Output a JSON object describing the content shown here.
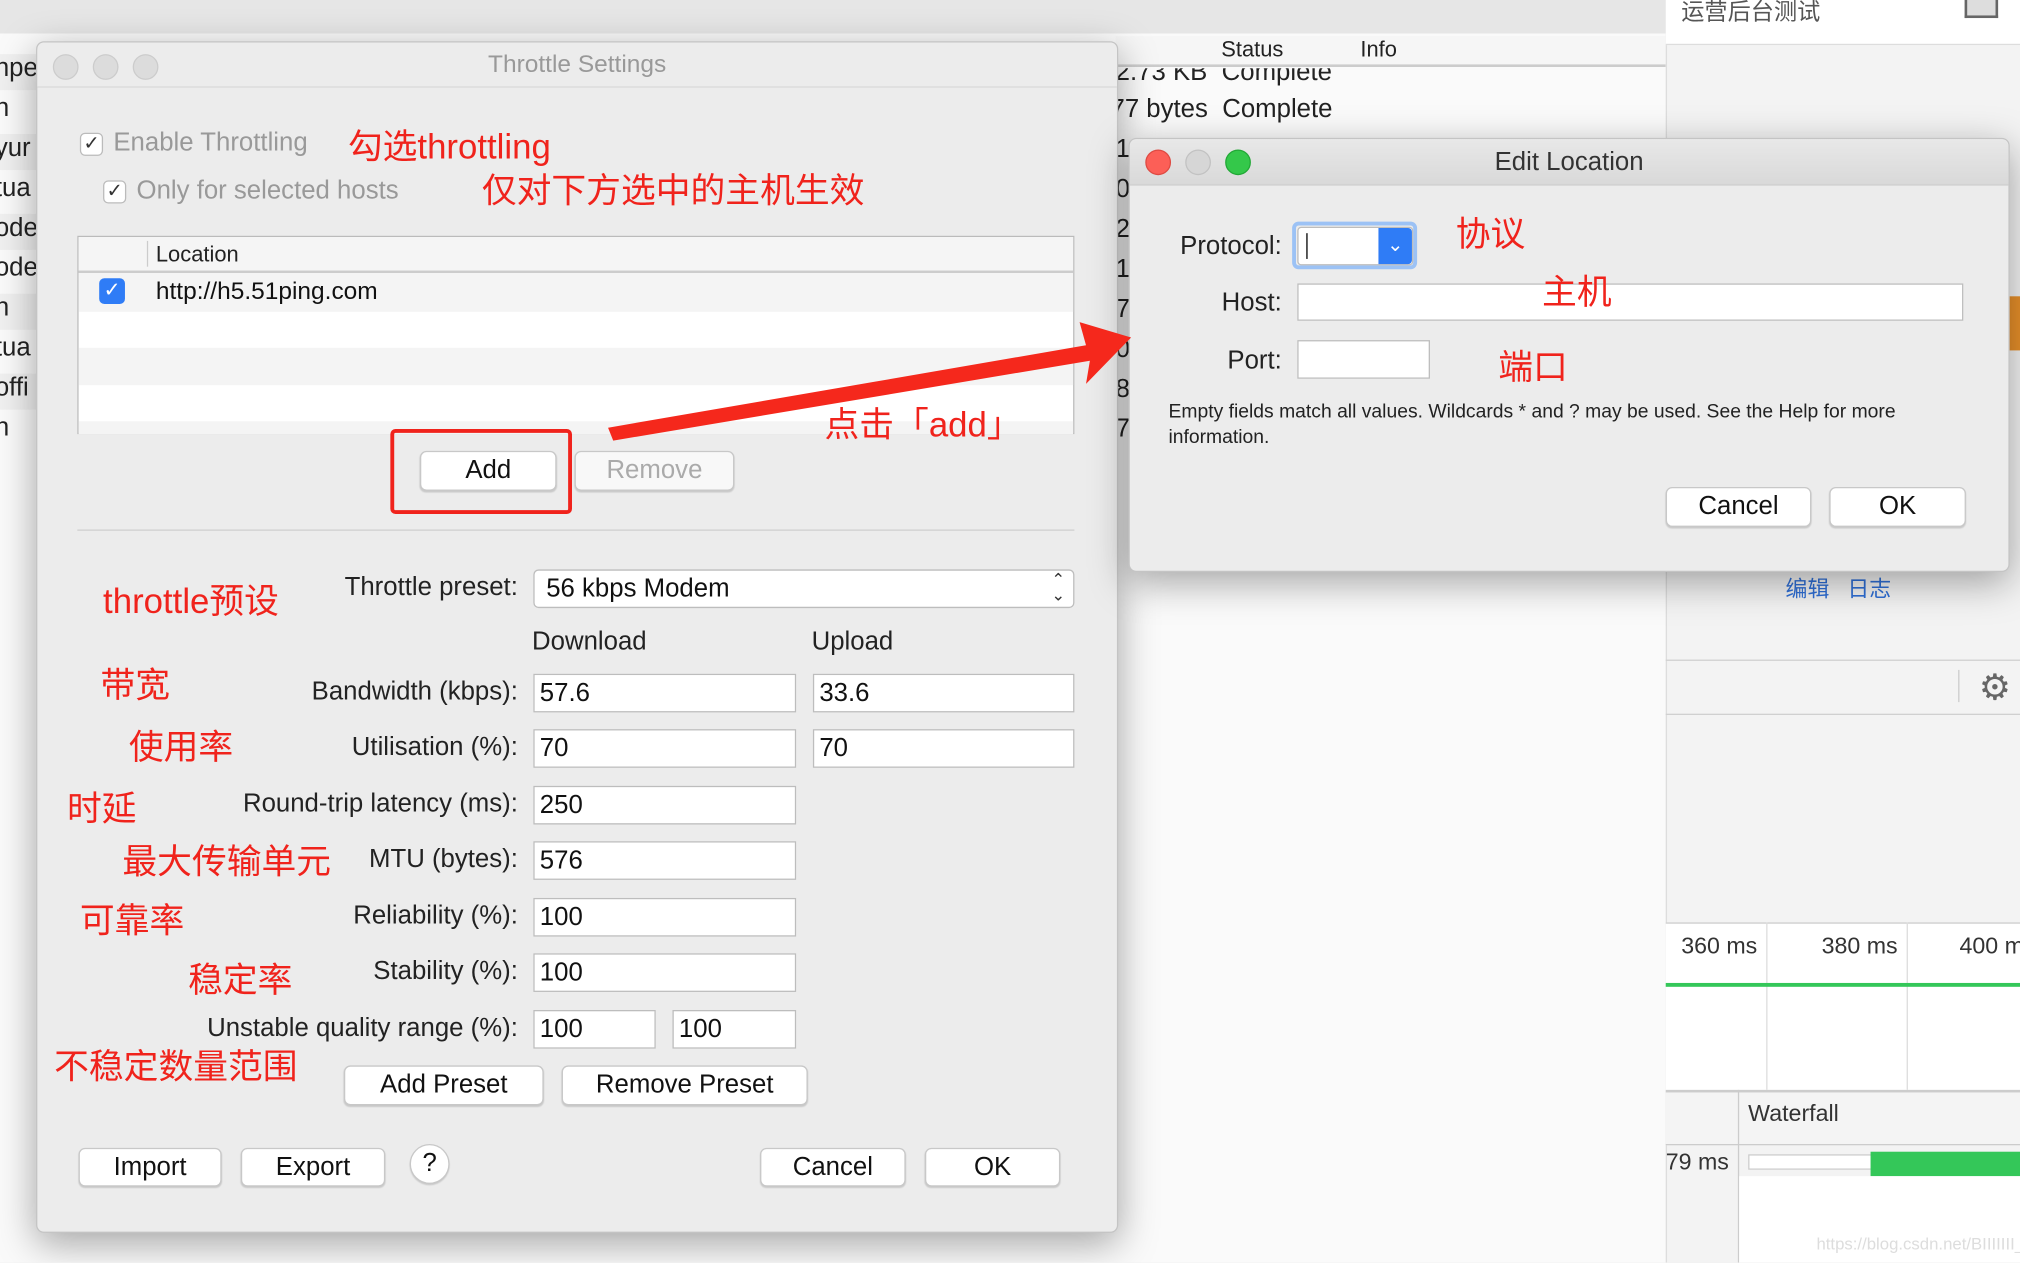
{
  "background": {
    "left_fragments": [
      "npe",
      "n",
      "yur",
      "tua",
      "oder",
      "oder",
      "n",
      "tua",
      "offi",
      "n"
    ],
    "columns": {
      "status": "Status",
      "info": "Info"
    },
    "rows": [
      {
        "size": "2.73 KB",
        "status": "Complete"
      },
      {
        "size": "77 bytes",
        "status": "Complete"
      }
    ],
    "num_fragments": [
      "1",
      "0",
      "2",
      "1",
      "7",
      "0",
      "8",
      "7"
    ],
    "right_title": "运营后台测试",
    "links": [
      "编辑",
      "日志"
    ],
    "timeline": [
      "360 ms",
      "380 ms",
      "400 m"
    ],
    "waterfall": "Waterfall",
    "duration": "79 ms",
    "watermark": "https://blog.csdn.net/BIIIIIII_"
  },
  "throttle": {
    "title": "Throttle Settings",
    "enable_label": "Enable Throttling",
    "enable_checked": true,
    "only_selected_label": "Only for selected hosts",
    "only_selected_checked": true,
    "table_header": "Location",
    "locations": [
      {
        "checked": true,
        "url": "http://h5.51ping.com"
      }
    ],
    "add": "Add",
    "remove": "Remove",
    "preset_label": "Throttle preset:",
    "preset_value": "56 kbps Modem",
    "download": "Download",
    "upload": "Upload",
    "fields": [
      {
        "label": "Bandwidth (kbps):",
        "down": "57.6",
        "up": "33.6"
      },
      {
        "label": "Utilisation (%):",
        "down": "70",
        "up": "70"
      },
      {
        "label": "Round-trip latency (ms):",
        "down": "250"
      },
      {
        "label": "MTU (bytes):",
        "down": "576"
      },
      {
        "label": "Reliability (%):",
        "down": "100"
      },
      {
        "label": "Stability (%):",
        "down": "100"
      },
      {
        "label": "Unstable quality range (%):",
        "down": "100",
        "up": "100"
      }
    ],
    "add_preset": "Add Preset",
    "remove_preset": "Remove Preset",
    "import": "Import",
    "export": "Export",
    "help": "?",
    "cancel": "Cancel",
    "ok": "OK"
  },
  "edit_location": {
    "title": "Edit Location",
    "protocol_label": "Protocol:",
    "protocol_value": "",
    "host_label": "Host:",
    "host_value": "",
    "port_label": "Port:",
    "port_value": "",
    "help_text": "Empty fields match all values. Wildcards * and ? may be used. See the Help for more information.",
    "cancel": "Cancel",
    "ok": "OK"
  },
  "annotations": {
    "enable": "勾选throttling",
    "only_selected": "仅对下方选中的主机生效",
    "click_add": "点击「add」",
    "preset": "throttle预设",
    "bandwidth": "带宽",
    "utilisation": "使用率",
    "latency": "时延",
    "mtu": "最大传输单元",
    "reliability": "可靠率",
    "stability": "稳定率",
    "unstable": "不稳定数量范围",
    "protocol": "协议",
    "host": "主机",
    "port": "端口"
  },
  "colors": {
    "annotation": "#f0231c",
    "accent_blue": "#2f7cf6",
    "green": "#34c759"
  }
}
